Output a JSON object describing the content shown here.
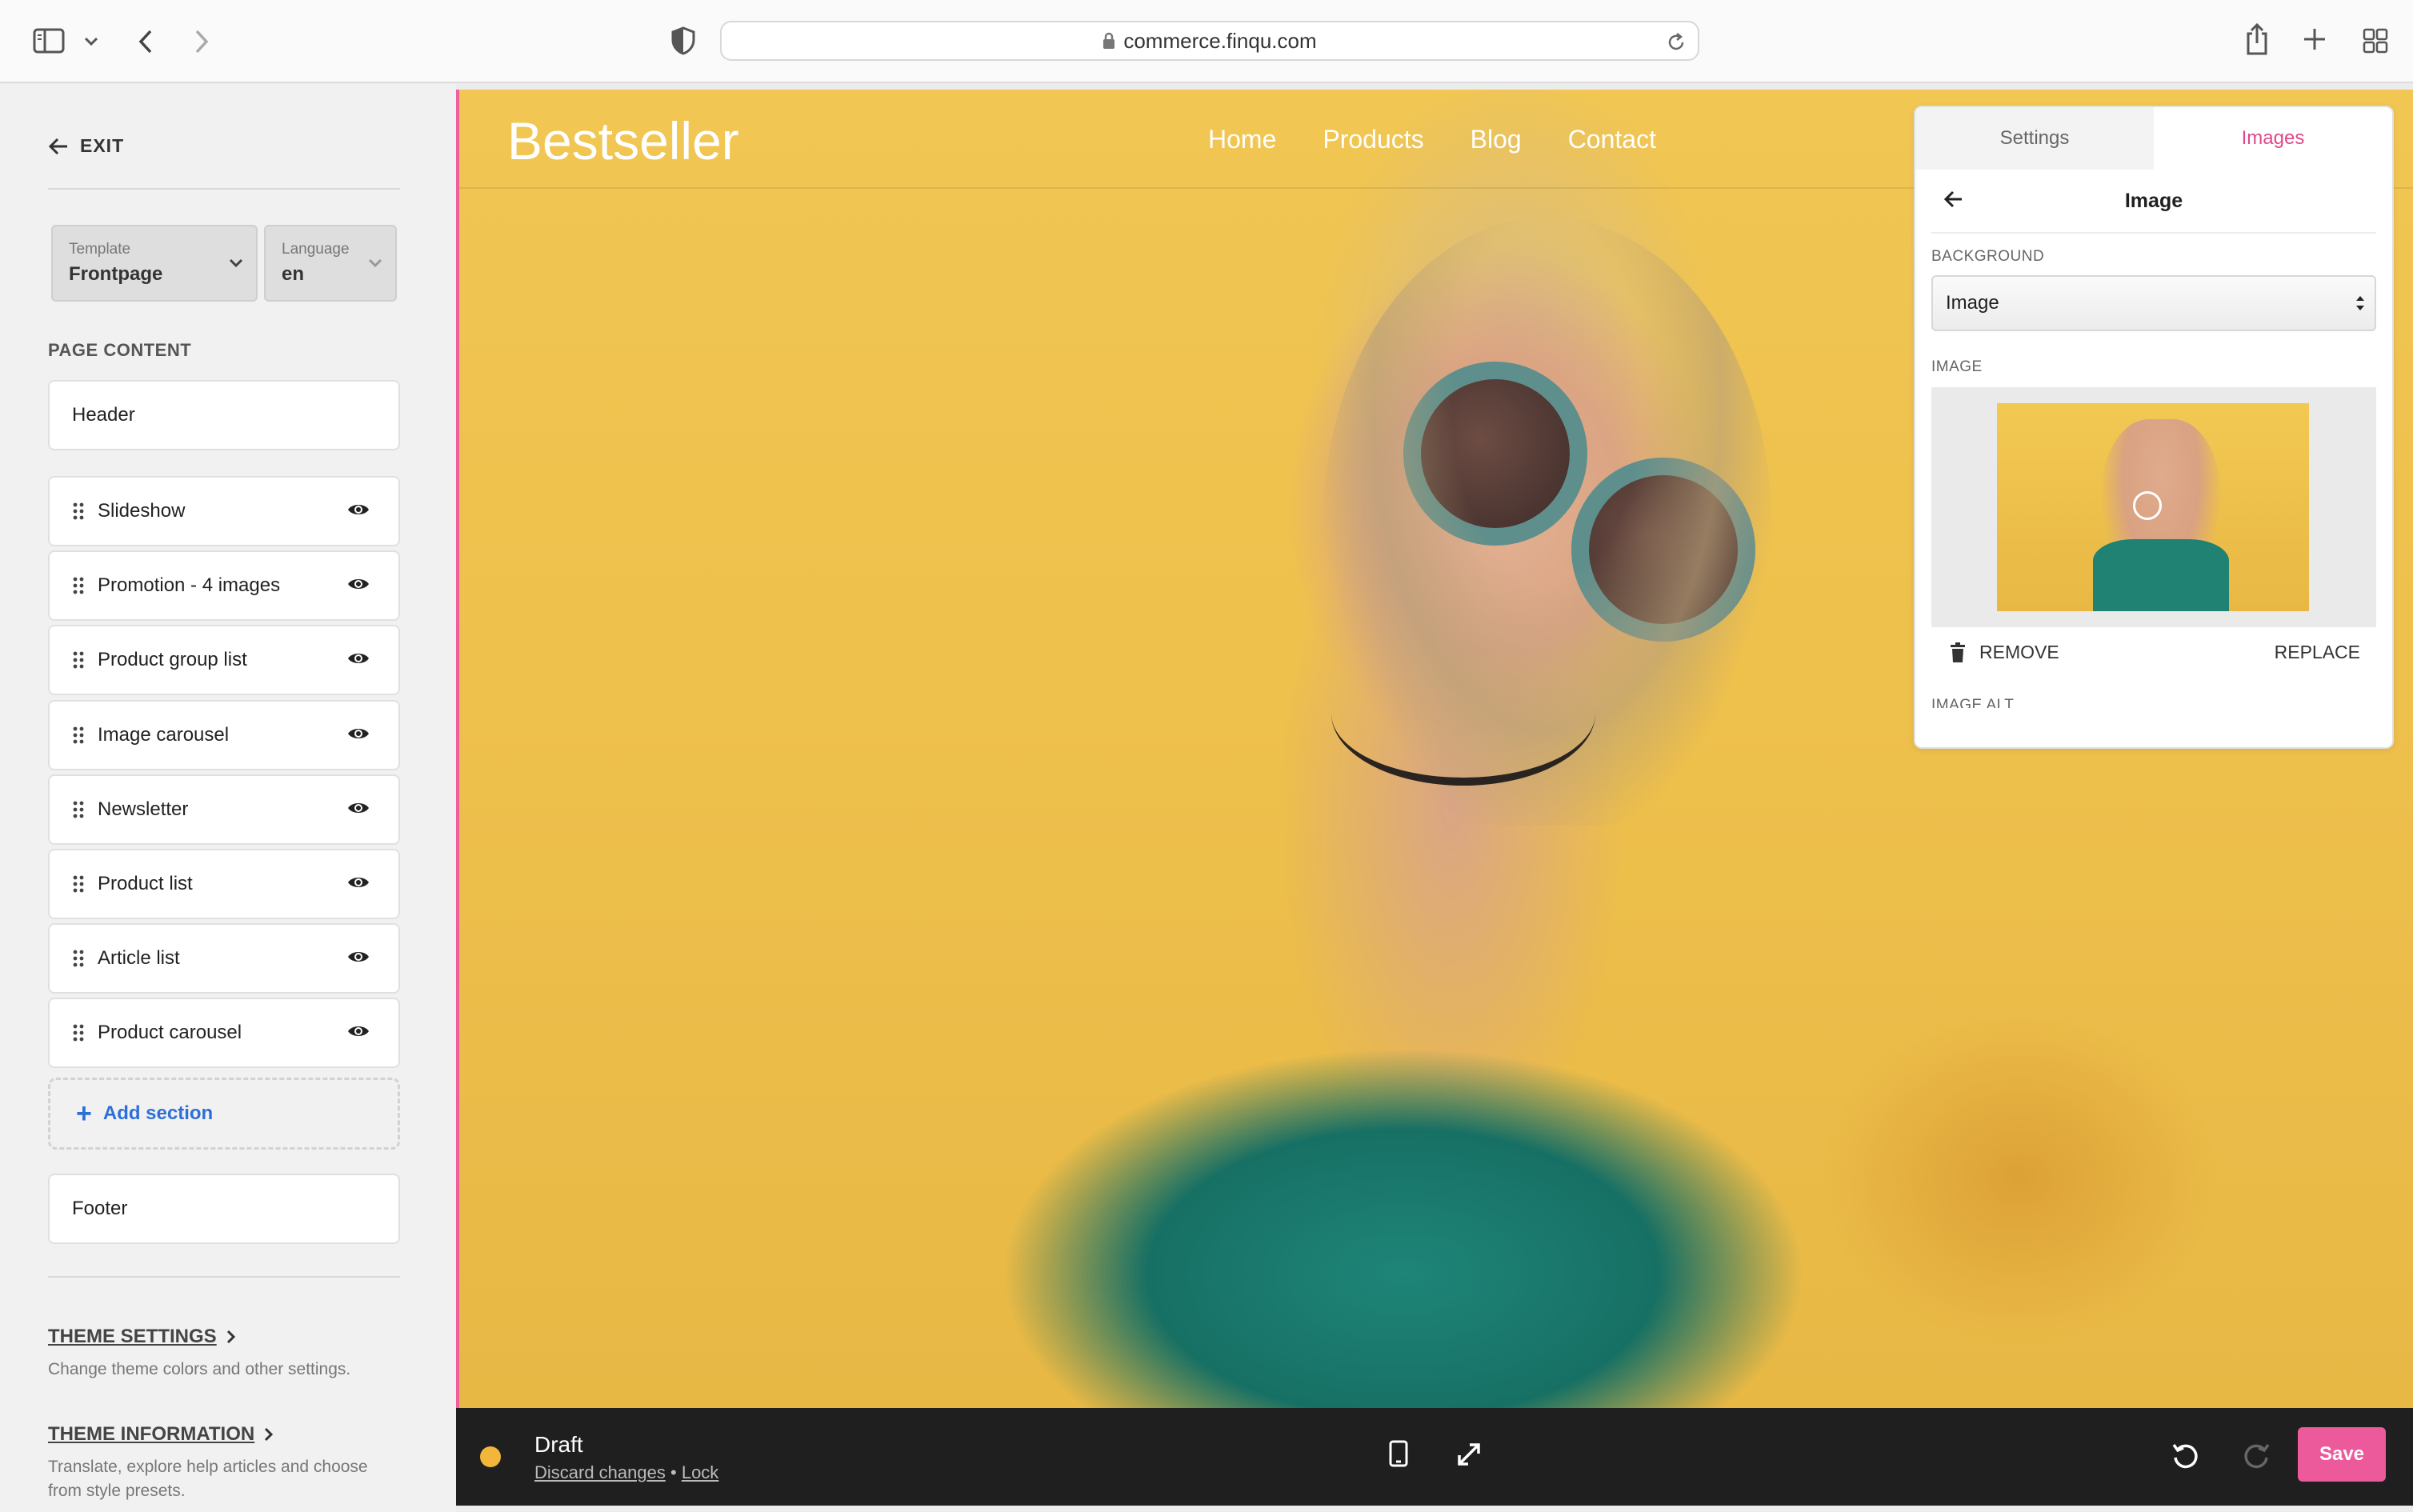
{
  "browser": {
    "url": "commerce.finqu.com",
    "icons": [
      "sidebar-toggle-icon",
      "chevron-down-icon",
      "back-arrow-icon",
      "forward-arrow-icon",
      "shield-icon",
      "lock-icon",
      "reload-icon",
      "share-icon",
      "new-tab-icon",
      "tab-overview-icon"
    ]
  },
  "sidebar": {
    "exit_label": "EXIT",
    "template": {
      "label": "Template",
      "value": "Frontpage"
    },
    "language": {
      "label": "Language",
      "value": "en"
    },
    "page_content_title": "PAGE CONTENT",
    "header_label": "Header",
    "sections": [
      {
        "label": "Slideshow"
      },
      {
        "label": "Promotion - 4 images"
      },
      {
        "label": "Product group list"
      },
      {
        "label": "Image carousel"
      },
      {
        "label": "Newsletter"
      },
      {
        "label": "Product list"
      },
      {
        "label": "Article list"
      },
      {
        "label": "Product carousel"
      }
    ],
    "add_section_label": "Add section",
    "footer_label": "Footer",
    "theme_settings": {
      "title": "THEME SETTINGS",
      "description": "Change theme colors and other settings."
    },
    "theme_information": {
      "title": "THEME INFORMATION",
      "description": "Translate, explore help articles and choose from style presets."
    }
  },
  "preview": {
    "brand": "Bestseller",
    "nav": [
      "Home",
      "Products",
      "Blog",
      "Contact"
    ],
    "accent_color": "#ee5fa0"
  },
  "panel": {
    "tabs": [
      "Settings",
      "Images"
    ],
    "active_tab": "Images",
    "title": "Image",
    "background_label": "BACKGROUND",
    "background_value": "Image",
    "image_label": "IMAGE",
    "remove_label": "REMOVE",
    "replace_label": "REPLACE",
    "image_alt_label": "IMAGE ALT"
  },
  "bottombar": {
    "status": "Draft",
    "status_color": "#f2b73a",
    "discard_label": "Discard changes",
    "separator": "•",
    "lock_label": "Lock",
    "save_label": "Save",
    "save_color": "#ec5a9b"
  }
}
